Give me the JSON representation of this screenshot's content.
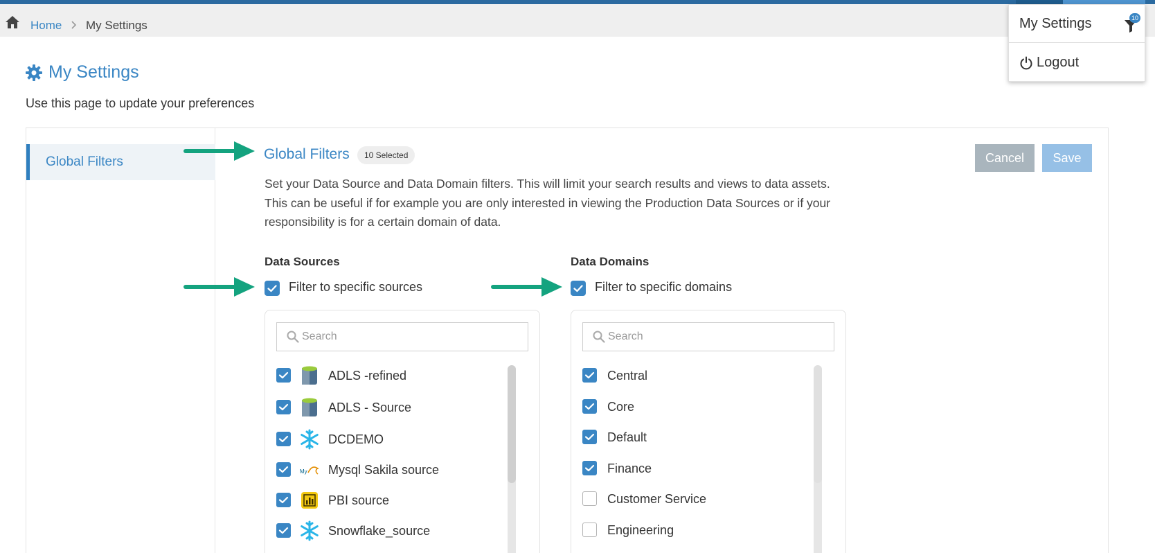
{
  "breadcrumb": {
    "home": "Home",
    "current": "My Settings"
  },
  "page": {
    "title": "My Settings",
    "subtitle": "Use this page to update your preferences"
  },
  "sidebar": {
    "items": [
      {
        "label": "Global Filters",
        "active": true
      }
    ]
  },
  "section": {
    "title": "Global Filters",
    "badge": "10 Selected",
    "description": "Set your Data Source and Data Domain filters. This will limit your search results and views to data assets. This can be useful if for example you are only interested in viewing the Production Data Sources or if your responsibility is for a certain domain of data.",
    "cancel_label": "Cancel",
    "save_label": "Save"
  },
  "sources": {
    "heading": "Data Sources",
    "filter_label": "Filter to specific sources",
    "filter_checked": true,
    "search_placeholder": "Search",
    "items": [
      {
        "label": "ADLS -refined",
        "icon": "azure-datalake-icon",
        "checked": true
      },
      {
        "label": "ADLS - Source",
        "icon": "azure-datalake-icon",
        "checked": true
      },
      {
        "label": "DCDEMO",
        "icon": "snowflake-icon",
        "checked": true
      },
      {
        "label": "Mysql Sakila source",
        "icon": "mysql-icon",
        "checked": true
      },
      {
        "label": "PBI source",
        "icon": "powerbi-icon",
        "checked": true
      },
      {
        "label": "Snowflake_source",
        "icon": "snowflake-icon",
        "checked": true
      }
    ]
  },
  "domains": {
    "heading": "Data Domains",
    "filter_label": "Filter to specific domains",
    "filter_checked": true,
    "search_placeholder": "Search",
    "items": [
      {
        "label": "Central",
        "checked": true
      },
      {
        "label": "Core",
        "checked": true
      },
      {
        "label": "Default",
        "checked": true
      },
      {
        "label": "Finance",
        "checked": true
      },
      {
        "label": "Customer Service",
        "checked": false
      },
      {
        "label": "Engineering",
        "checked": false
      }
    ]
  },
  "user_menu": {
    "settings_label": "My Settings",
    "filter_badge": "10",
    "logout_label": "Logout"
  },
  "colors": {
    "accent": "#3a86c4",
    "annotation_arrow": "#14a37f"
  }
}
